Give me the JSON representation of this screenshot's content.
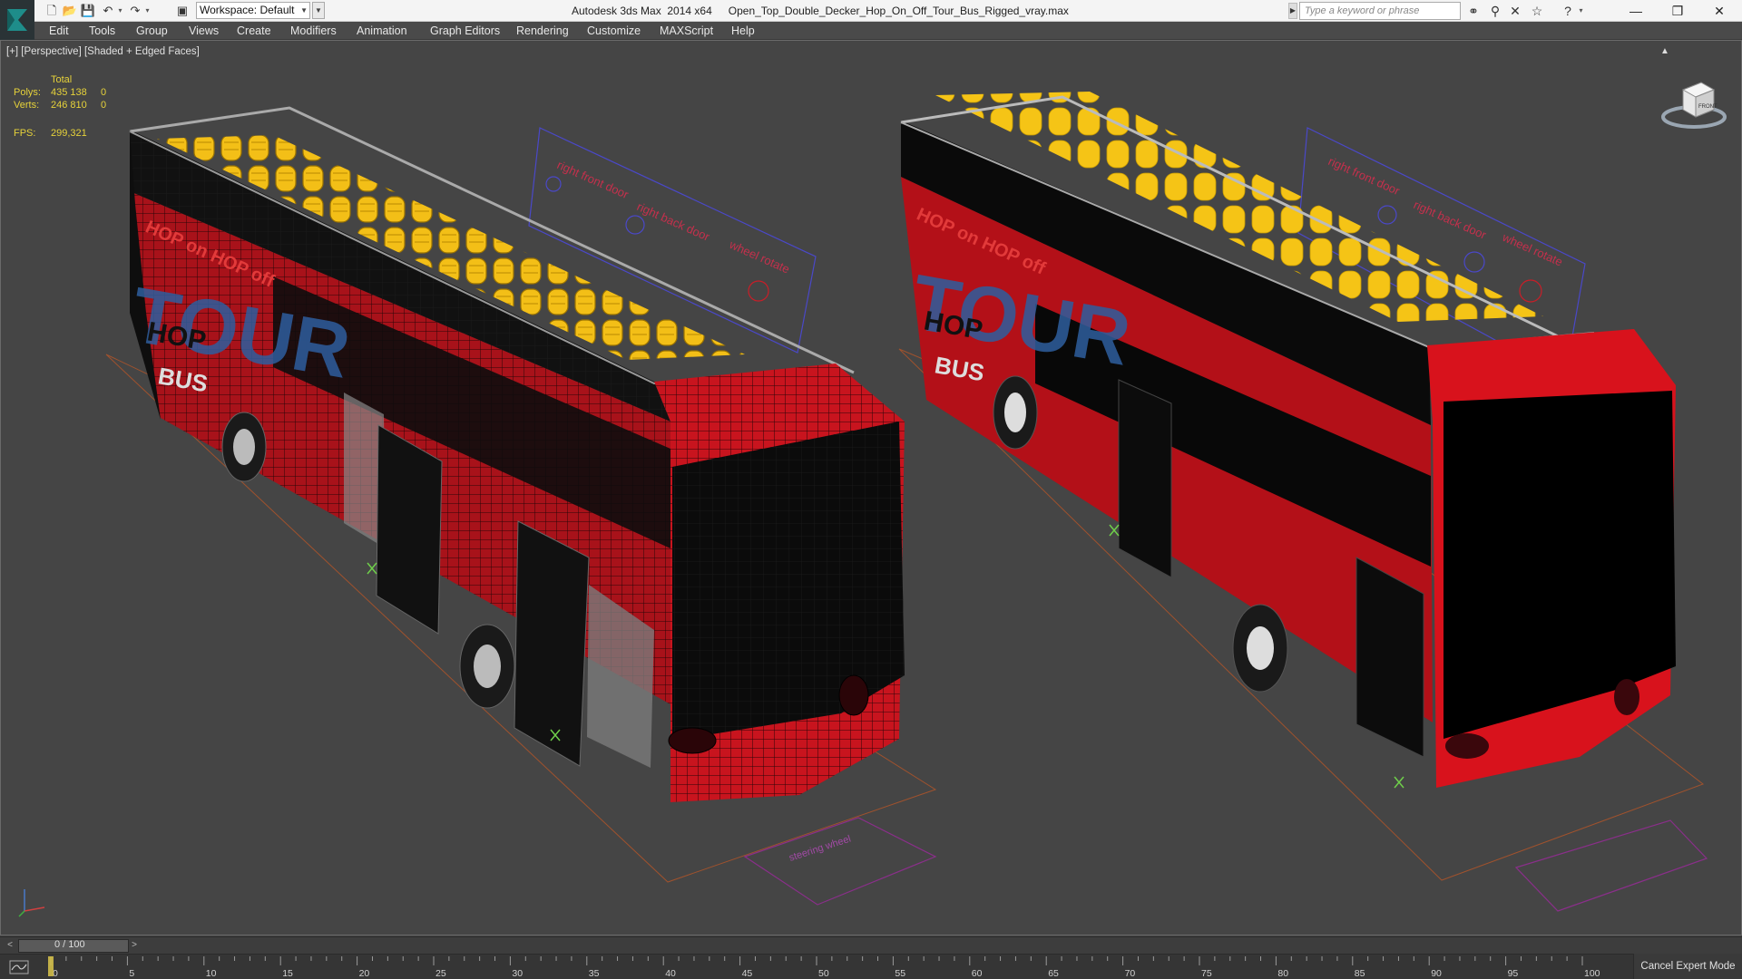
{
  "titlebar": {
    "app_title": "Autodesk 3ds Max  2014 x64",
    "file_name": "Open_Top_Double_Decker_Hop_On_Off_Tour_Bus_Rigged_vray.max",
    "workspace_label": "Workspace: Default",
    "search_placeholder": "Type a keyword or phrase"
  },
  "menus": [
    "Edit",
    "Tools",
    "Group",
    "Views",
    "Create",
    "Modifiers",
    "Animation",
    "Graph Editors",
    "Rendering",
    "Customize",
    "MAXScript",
    "Help"
  ],
  "viewport": {
    "label": "[+] [Perspective] [Shaded + Edged Faces]",
    "stats": {
      "header": "Total",
      "polys_label": "Polys:",
      "polys_total": "435 138",
      "polys_selected": "0",
      "verts_label": "Verts:",
      "verts_total": "246 810",
      "verts_selected": "0",
      "fps_label": "FPS:",
      "fps_value": "299,321"
    },
    "viewcube_face": "FRONT"
  },
  "bus_decals": {
    "hop_text": "HOP on HOP off",
    "tour_text": "TOUR",
    "hop_big": "HOP",
    "bus_big": "BUS",
    "rig_right_front_door": "right front door",
    "rig_right_back_door": "right back door",
    "rig_wheel_rotate": "wheel rotate",
    "rig_steering_wheel": "steering wheel"
  },
  "time_slider": {
    "label": "0 / 100",
    "prev": "<",
    "next": ">"
  },
  "track_ticks": [
    "0",
    "5",
    "10",
    "15",
    "20",
    "25",
    "30",
    "35",
    "40",
    "45",
    "50",
    "55",
    "60",
    "65",
    "70",
    "75",
    "80",
    "85",
    "90",
    "95",
    "100"
  ],
  "cancel_expert_label": "Cancel Expert Mode",
  "colors": {
    "bus_red": "#c8141e",
    "seat_yellow": "#f3bf17",
    "stats_yellow": "#e6d23a",
    "viewport_bg": "#454545",
    "rig_blue": "#4a48c8"
  }
}
